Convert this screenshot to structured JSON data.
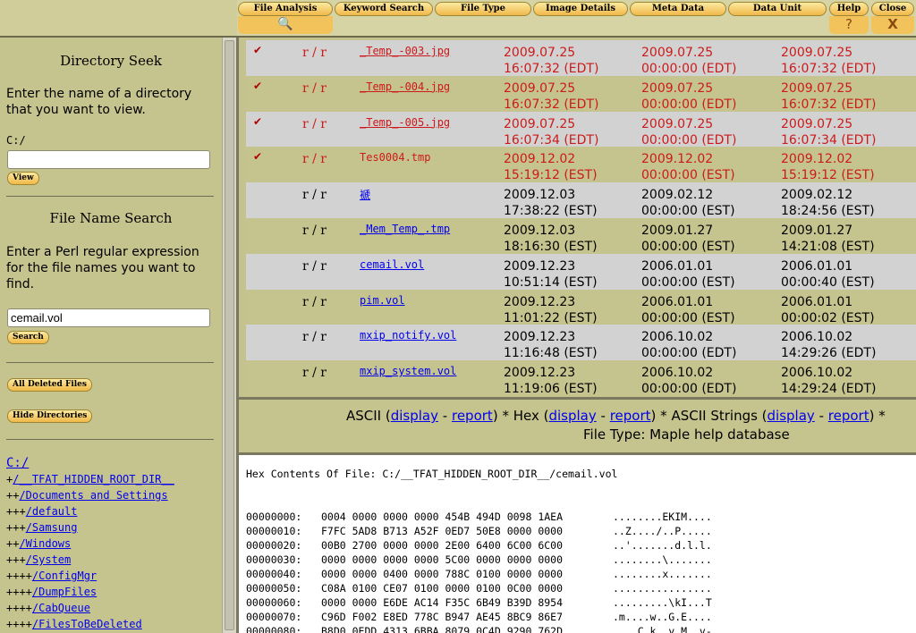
{
  "tabs": [
    {
      "label": "File Analysis",
      "sub": "🔍"
    },
    {
      "label": "Keyword Search"
    },
    {
      "label": "File Type"
    },
    {
      "label": "Image Details"
    },
    {
      "label": "Meta Data"
    },
    {
      "label": "Data Unit"
    },
    {
      "label": "Help",
      "sub": "?"
    },
    {
      "label": "Close",
      "sub": "X"
    }
  ],
  "left": {
    "directory_seek": {
      "title": "Directory Seek",
      "text": "Enter the name of a directory that you want to view.",
      "path": "C:/",
      "input_value": "",
      "button": "View"
    },
    "file_name_search": {
      "title": "File Name Search",
      "text": "Enter a Perl regular expression for the file names you want to find.",
      "input_value": "cemail.vol",
      "button": "Search"
    },
    "all_deleted_button": "All Deleted Files",
    "hide_dirs_button": "Hide Directories",
    "tree": [
      {
        "prefix": "",
        "name": "C:/"
      },
      {
        "prefix": "+",
        "name": "/__TFAT_HIDDEN_ROOT_DIR__"
      },
      {
        "prefix": "++",
        "name": "/Documents and Settings"
      },
      {
        "prefix": "+++",
        "name": "/default"
      },
      {
        "prefix": "+++",
        "name": "/Samsung"
      },
      {
        "prefix": "++",
        "name": "/Windows"
      },
      {
        "prefix": "+++",
        "name": "/System"
      },
      {
        "prefix": "++++",
        "name": "/ConfigMgr"
      },
      {
        "prefix": "++++",
        "name": "/DumpFiles"
      },
      {
        "prefix": "++++",
        "name": "/CabQueue"
      },
      {
        "prefix": "++++",
        "name": "/FilesToBeDeleted"
      }
    ]
  },
  "files": [
    {
      "check": "✔",
      "perm": "r / r",
      "name": "_Temp_-003.jpg",
      "link": true,
      "deleted": true,
      "d1a": "2009.07.25",
      "d1b": "16:07:32 (EDT)",
      "d2a": "2009.07.25",
      "d2b": "00:00:00 (EDT)",
      "d3a": "2009.07.25",
      "d3b": "16:07:32 (EDT)"
    },
    {
      "check": "✔",
      "perm": "r / r",
      "name": "_Temp_-004.jpg",
      "link": true,
      "deleted": true,
      "d1a": "2009.07.25",
      "d1b": "16:07:32 (EDT)",
      "d2a": "2009.07.25",
      "d2b": "00:00:00 (EDT)",
      "d3a": "2009.07.25",
      "d3b": "16:07:32 (EDT)"
    },
    {
      "check": "✔",
      "perm": "r / r",
      "name": "_Temp_-005.jpg",
      "link": true,
      "deleted": true,
      "d1a": "2009.07.25",
      "d1b": "16:07:34 (EDT)",
      "d2a": "2009.07.25",
      "d2b": "00:00:00 (EDT)",
      "d3a": "2009.07.25",
      "d3b": "16:07:34 (EDT)"
    },
    {
      "check": "✔",
      "perm": "r / r",
      "name": "Tes0004.tmp",
      "link": false,
      "deleted": true,
      "d1a": "2009.12.02",
      "d1b": "15:19:12 (EST)",
      "d2a": "2009.12.02",
      "d2b": "00:00:00 (EST)",
      "d3a": "2009.12.02",
      "d3b": "15:19:12 (EST)"
    },
    {
      "check": "",
      "perm": "r / r",
      "name": "褫",
      "link": true,
      "deleted": false,
      "d1a": "2009.12.03",
      "d1b": "17:38:22 (EST)",
      "d2a": "2009.02.12",
      "d2b": "00:00:00 (EST)",
      "d3a": "2009.02.12",
      "d3b": "18:24:56 (EST)"
    },
    {
      "check": "",
      "perm": "r / r",
      "name": "_Mem_Temp_.tmp",
      "link": true,
      "deleted": false,
      "d1a": "2009.12.03",
      "d1b": "18:16:30 (EST)",
      "d2a": "2009.01.27",
      "d2b": "00:00:00 (EST)",
      "d3a": "2009.01.27",
      "d3b": "14:21:08 (EST)"
    },
    {
      "check": "",
      "perm": "r / r",
      "name": "cemail.vol",
      "link": true,
      "deleted": false,
      "d1a": "2009.12.23",
      "d1b": "10:51:14 (EST)",
      "d2a": "2006.01.01",
      "d2b": "00:00:00 (EST)",
      "d3a": "2006.01.01",
      "d3b": "00:00:40 (EST)"
    },
    {
      "check": "",
      "perm": "r / r",
      "name": "pim.vol",
      "link": true,
      "deleted": false,
      "d1a": "2009.12.23",
      "d1b": "11:01:22 (EST)",
      "d2a": "2006.01.01",
      "d2b": "00:00:00 (EST)",
      "d3a": "2006.01.01",
      "d3b": "00:00:02 (EST)"
    },
    {
      "check": "",
      "perm": "r / r",
      "name": "mxip_notify.vol",
      "link": true,
      "deleted": false,
      "d1a": "2009.12.23",
      "d1b": "11:16:48 (EST)",
      "d2a": "2006.10.02",
      "d2b": "00:00:00 (EDT)",
      "d3a": "2006.10.02",
      "d3b": "14:29:26 (EDT)"
    },
    {
      "check": "",
      "perm": "r / r",
      "name": "mxip_system.vol",
      "link": true,
      "deleted": false,
      "d1a": "2009.12.23",
      "d1b": "11:19:06 (EST)",
      "d2a": "2006.10.02",
      "d2b": "00:00:00 (EDT)",
      "d3a": "2006.10.02",
      "d3b": "14:29:24 (EDT)"
    }
  ],
  "modebar": {
    "ascii": "ASCII",
    "hex": "Hex",
    "ascii_strings": "ASCII Strings",
    "display": "display",
    "report": "report",
    "sep": "-",
    "star": "*",
    "file_type": "File Type: Maple help database"
  },
  "hex": {
    "title": "Hex Contents Of File: C:/__TFAT_HIDDEN_ROOT_DIR__/cemail.vol",
    "rows": [
      {
        "off": "00000000:",
        "hex": "0004 0000 0000 0000 454B 494D 0098 1AEA",
        "ascii": "........EKIM...."
      },
      {
        "off": "00000010:",
        "hex": "F7FC 5AD8 B713 A52F 0ED7 50E8 0000 0000",
        "ascii": "..Z..../..P....."
      },
      {
        "off": "00000020:",
        "hex": "00B0 2700 0000 0000 2E00 6400 6C00 6C00",
        "ascii": "..'.......d.l.l."
      },
      {
        "off": "00000030:",
        "hex": "0000 0000 0000 0000 5C00 0000 0000 0000",
        "ascii": "........\\......."
      },
      {
        "off": "00000040:",
        "hex": "0000 0000 0400 0000 788C 0100 0000 0000",
        "ascii": "........x......."
      },
      {
        "off": "00000050:",
        "hex": "C08A 0100 CE07 0100 0000 0100 0C00 0000",
        "ascii": "................"
      },
      {
        "off": "00000060:",
        "hex": "0000 0000 E6DE AC14 F35C 6B49 B39D 8954",
        "ascii": ".........\\kI...T"
      },
      {
        "off": "00000070:",
        "hex": "C96D F002 E8ED 778C B947 AE45 8BC9 86E7",
        "ascii": ".m....w..G.E...."
      },
      {
        "off": "00000080:",
        "hex": "B8D0 0EDD 4313 6BBA 8079 0C4D 9290 762D",
        "ascii": "....C.k..y.M..v-"
      }
    ]
  }
}
